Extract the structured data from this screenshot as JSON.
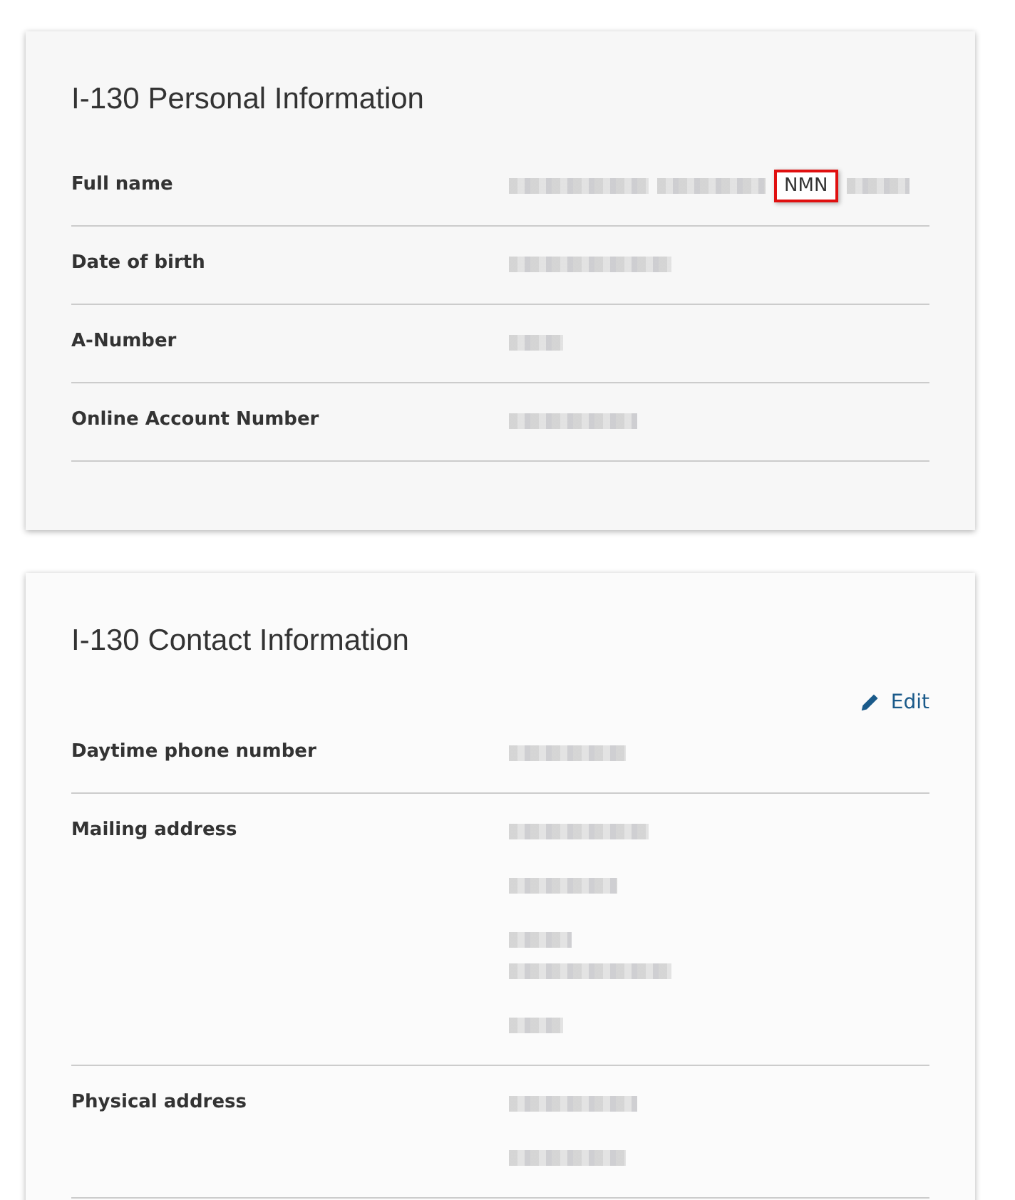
{
  "cards": [
    {
      "title": "I-130 Personal Information",
      "rows": [
        {
          "label": "Full name",
          "blocks": [
            [
              [
                {
                  "kind": "redacted"
                },
                {
                  "kind": "redacted"
                },
                {
                  "kind": "text",
                  "text": "NMN",
                  "highlighted": true
                },
                {
                  "kind": "redacted"
                }
              ]
            ]
          ]
        },
        {
          "label": "Date of birth",
          "blocks": [
            [
              [
                {
                  "kind": "redacted"
                }
              ]
            ]
          ]
        },
        {
          "label": "A-Number",
          "blocks": [
            [
              [
                {
                  "kind": "redacted"
                }
              ]
            ]
          ]
        },
        {
          "label": "Online Account Number",
          "blocks": [
            [
              [
                {
                  "kind": "redacted"
                }
              ]
            ]
          ]
        }
      ]
    },
    {
      "title": "I-130 Contact Information",
      "action": "Edit",
      "rows": [
        {
          "label": "Daytime phone number",
          "blocks": [
            [
              [
                {
                  "kind": "redacted"
                }
              ]
            ]
          ]
        },
        {
          "label": "Mailing address",
          "blocks": [
            [
              [
                {
                  "kind": "redacted"
                }
              ]
            ],
            [
              [
                {
                  "kind": "redacted"
                }
              ]
            ],
            [
              [
                {
                  "kind": "redacted"
                }
              ],
              [
                {
                  "kind": "redacted"
                }
              ]
            ],
            [
              [
                {
                  "kind": "redacted"
                }
              ]
            ]
          ]
        },
        {
          "label": "Physical address",
          "blocks": [
            [
              [
                {
                  "kind": "redacted"
                }
              ]
            ],
            [
              [
                {
                  "kind": "redacted"
                }
              ]
            ]
          ]
        }
      ]
    }
  ]
}
